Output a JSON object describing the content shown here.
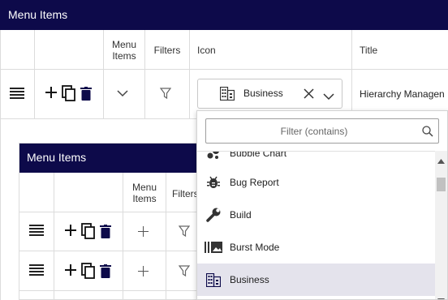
{
  "outer": {
    "title": "Menu Items",
    "columns": {
      "menu_items": "Menu\nItems",
      "filters": "Filters",
      "icon": "Icon",
      "title": "Title"
    },
    "row": {
      "icon_value": "Business",
      "title_value": "Hierarchy Managen"
    }
  },
  "inner": {
    "title": "Menu Items",
    "columns": {
      "menu_items": "Menu\nItems",
      "filters": "Filters"
    }
  },
  "dropdown": {
    "filter_placeholder": "Filter (contains)",
    "partial_label": "Bubble Chart",
    "options": [
      {
        "label": "Bug Report",
        "icon": "bug-report-icon"
      },
      {
        "label": "Build",
        "icon": "build-icon"
      },
      {
        "label": "Burst Mode",
        "icon": "burst-mode-icon"
      },
      {
        "label": "Business",
        "icon": "business-icon",
        "selected": true
      }
    ]
  },
  "colors": {
    "header": "#0d0a4a",
    "selected_option": "#e4e3ec"
  }
}
